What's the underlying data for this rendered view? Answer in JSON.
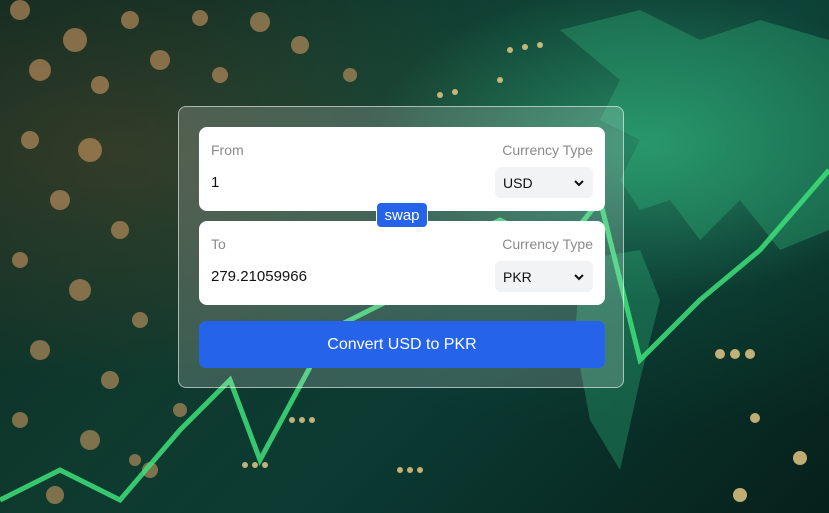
{
  "converter": {
    "from": {
      "label": "From",
      "currency_type_label": "Currency Type",
      "amount": "1",
      "currency": "USD"
    },
    "swap_label": "swap",
    "to": {
      "label": "To",
      "currency_type_label": "Currency Type",
      "amount": "279.21059966",
      "currency": "PKR"
    },
    "convert_label": "Convert USD to PKR"
  },
  "colors": {
    "accent": "#2563eb",
    "chart_line": "#3ee07a"
  }
}
